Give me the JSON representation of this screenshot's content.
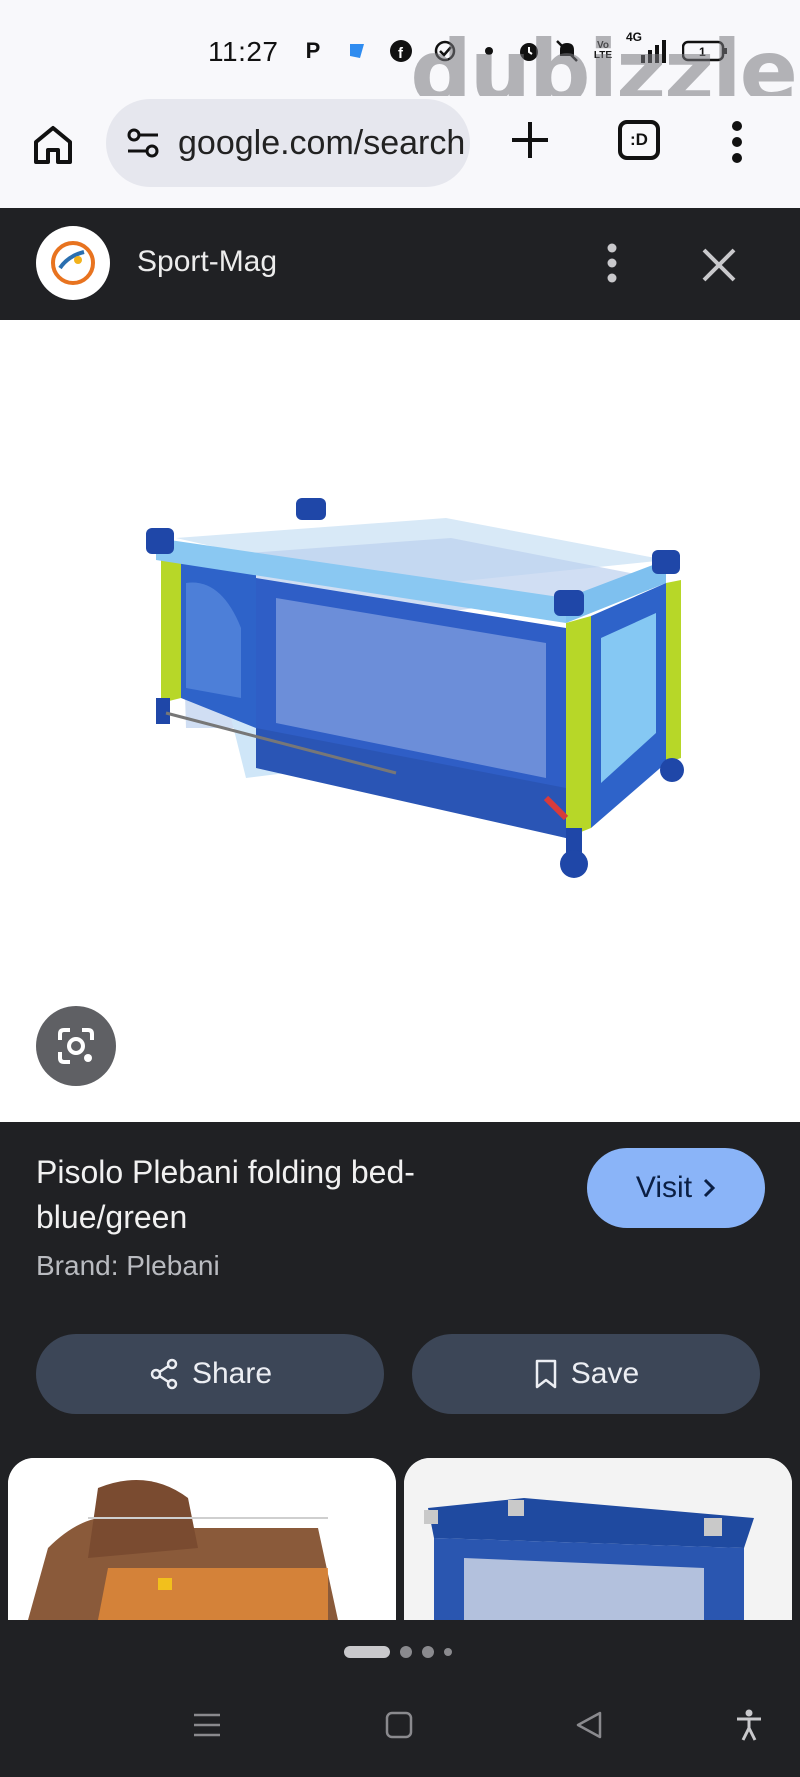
{
  "status_bar": {
    "time": "11:27",
    "icons": [
      "p-icon",
      "blue-app-icon",
      "facebook-icon",
      "check-circle-icon",
      "dot-icon",
      "alarm-icon",
      "mute-icon",
      "volte-icon",
      "4g-signal-icon",
      "battery-icon"
    ],
    "volte_label": "Vo LTE",
    "network_label": "4G",
    "battery_level": "1",
    "watermark": "dubizzle"
  },
  "browser": {
    "url": "google.com/search",
    "tabs_label": ":D"
  },
  "sheet": {
    "site_name": "Sport-Mag"
  },
  "product": {
    "title": "Pisolo Plebani folding bed-blue/green",
    "brand": "Brand: Plebani",
    "visit_label": "Visit",
    "share_label": "Share",
    "save_label": "Save"
  },
  "colors": {
    "dark_bg": "#202124",
    "accent_button": "#8ab4f8",
    "secondary_button": "#3c4657"
  }
}
